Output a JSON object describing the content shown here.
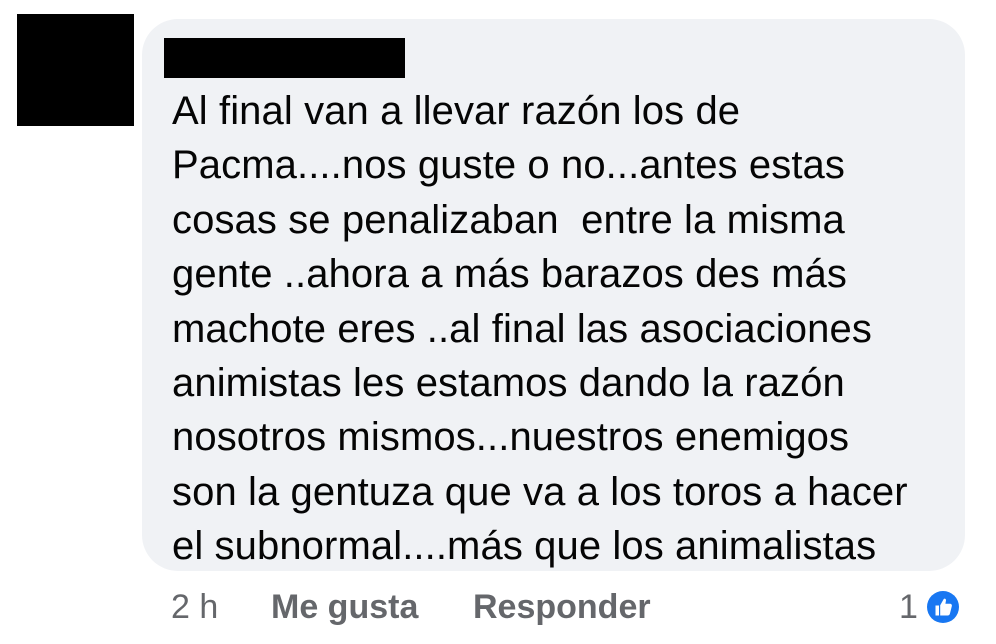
{
  "comment": {
    "author_name": "",
    "text_lines": [
      "Al final van a llevar razón los de",
      "Pacma....nos guste o no...antes estas",
      "cosas se penalizaban  entre la misma",
      "gente ..ahora a más barazos des más",
      "machote eres ..al final las asociaciones",
      "animistas les estamos dando la razón",
      "nosotros mismos...nuestros enemigos",
      "son la gentuza que va a los toros a hacer",
      "el subnormal....más que los animalistas"
    ]
  },
  "actions": {
    "timestamp": "2 h",
    "like_label": "Me gusta",
    "reply_label": "Responder"
  },
  "reactions": {
    "count": "1",
    "icon": "thumbs-up-icon",
    "color": "#1877f2"
  },
  "colors": {
    "bubble": "#f0f2f5",
    "text": "#050505",
    "secondary_text": "#65676b"
  }
}
